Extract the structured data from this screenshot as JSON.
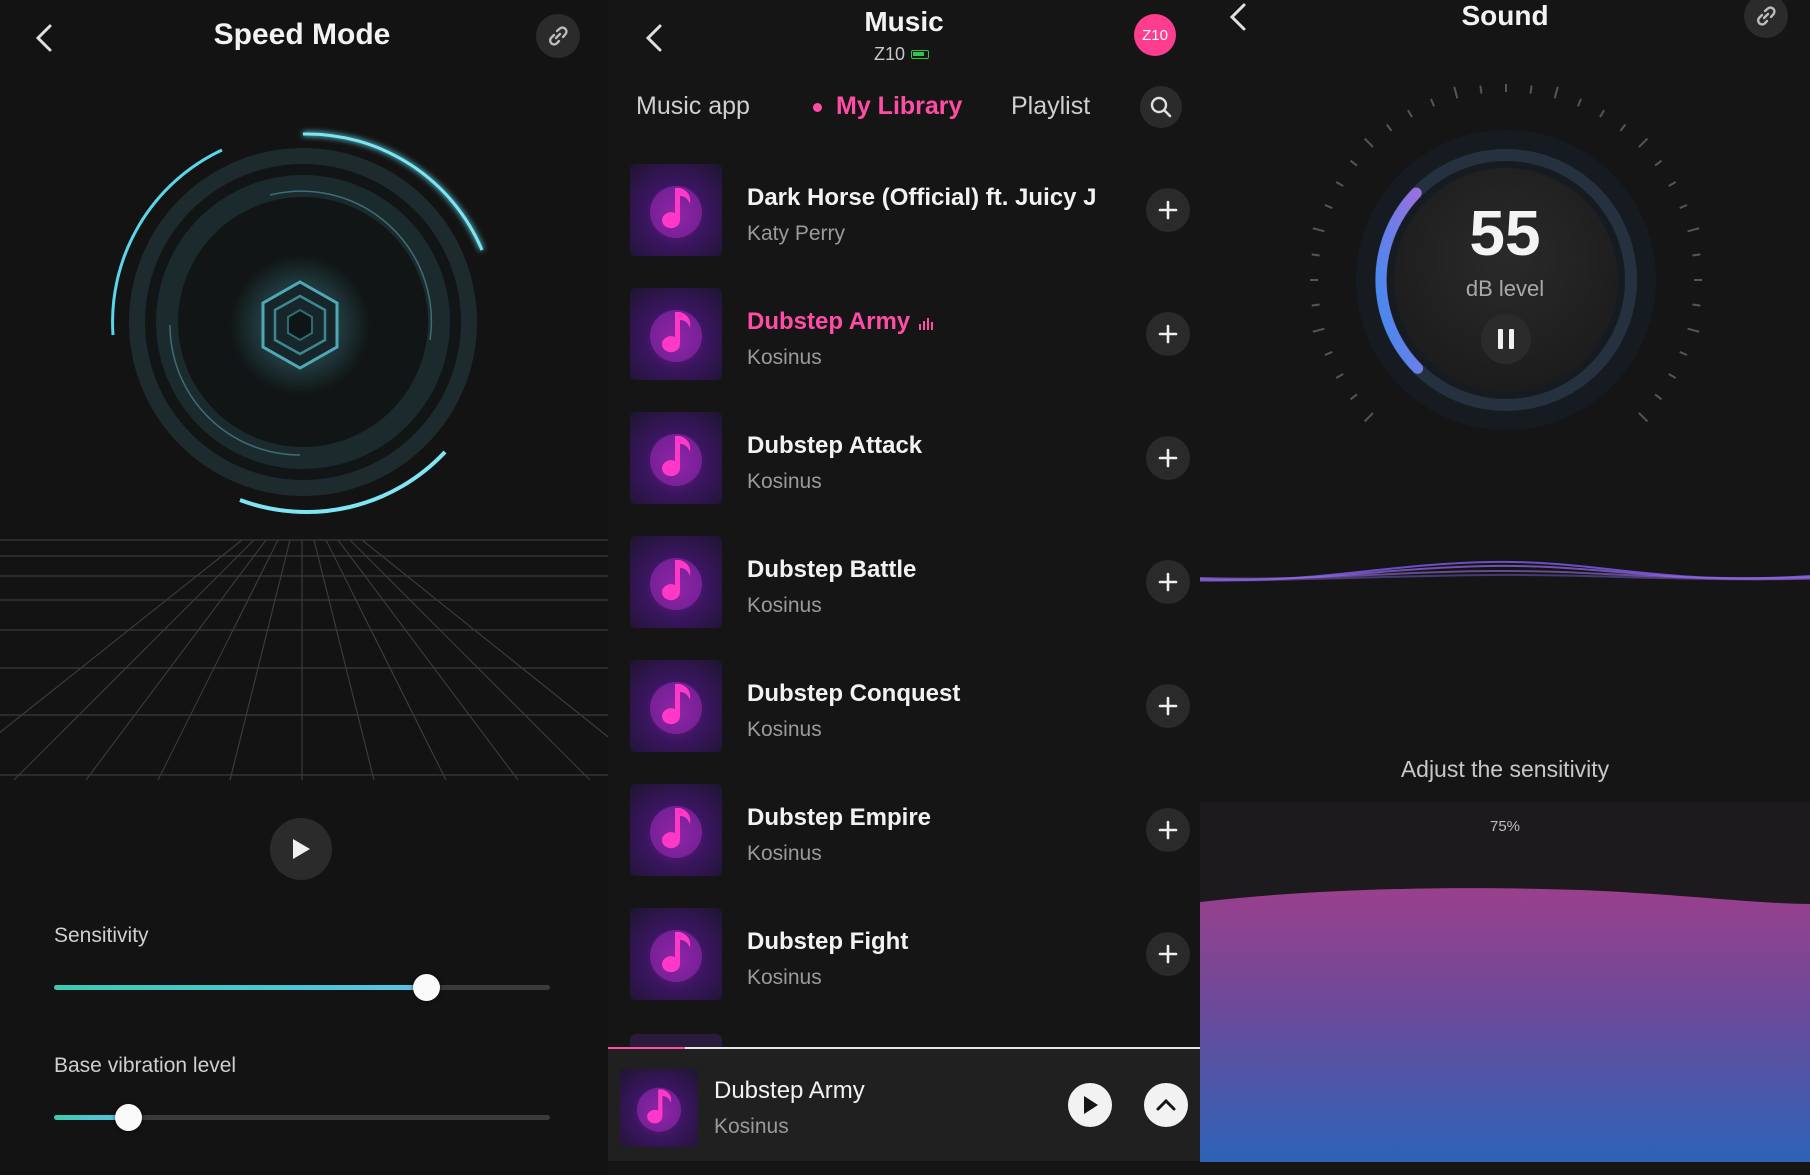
{
  "speed_mode": {
    "title": "Speed Mode",
    "sensitivity_label": "Sensitivity",
    "sensitivity_value": 0.75,
    "base_vibration_label": "Base vibration level",
    "base_vibration_value": 0.15,
    "accent": "#54c8e0"
  },
  "music": {
    "title": "Music",
    "device_name": "Z10",
    "device_badge": "Z10",
    "badge_color": "#ff3d8f",
    "battery_color": "#35c24a",
    "tabs": [
      {
        "label": "Music app",
        "active": false
      },
      {
        "label": "My Library",
        "active": true
      },
      {
        "label": "Playlist",
        "active": false
      }
    ],
    "songs": [
      {
        "title": "Dark Horse (Official) ft. Juicy J",
        "artist": "Katy Perry",
        "playing": false
      },
      {
        "title": "Dubstep Army",
        "artist": "Kosinus",
        "playing": true
      },
      {
        "title": "Dubstep Attack",
        "artist": "Kosinus",
        "playing": false
      },
      {
        "title": "Dubstep Battle",
        "artist": "Kosinus",
        "playing": false
      },
      {
        "title": "Dubstep Conquest",
        "artist": "Kosinus",
        "playing": false
      },
      {
        "title": "Dubstep Empire",
        "artist": "Kosinus",
        "playing": false
      },
      {
        "title": "Dubstep Fight",
        "artist": "Kosinus",
        "playing": false
      }
    ],
    "now_playing": {
      "title": "Dubstep Army",
      "artist": "Kosinus",
      "progress": 0.13
    },
    "accent": "#ff4da6"
  },
  "sound": {
    "title": "Sound",
    "db_value": "55",
    "db_label": "dB level",
    "db_gauge_fraction": 0.33,
    "sensitivity_label": "Adjust the sensitivity",
    "sensitivity_percent": "75%",
    "sensitivity_value": 0.75
  }
}
